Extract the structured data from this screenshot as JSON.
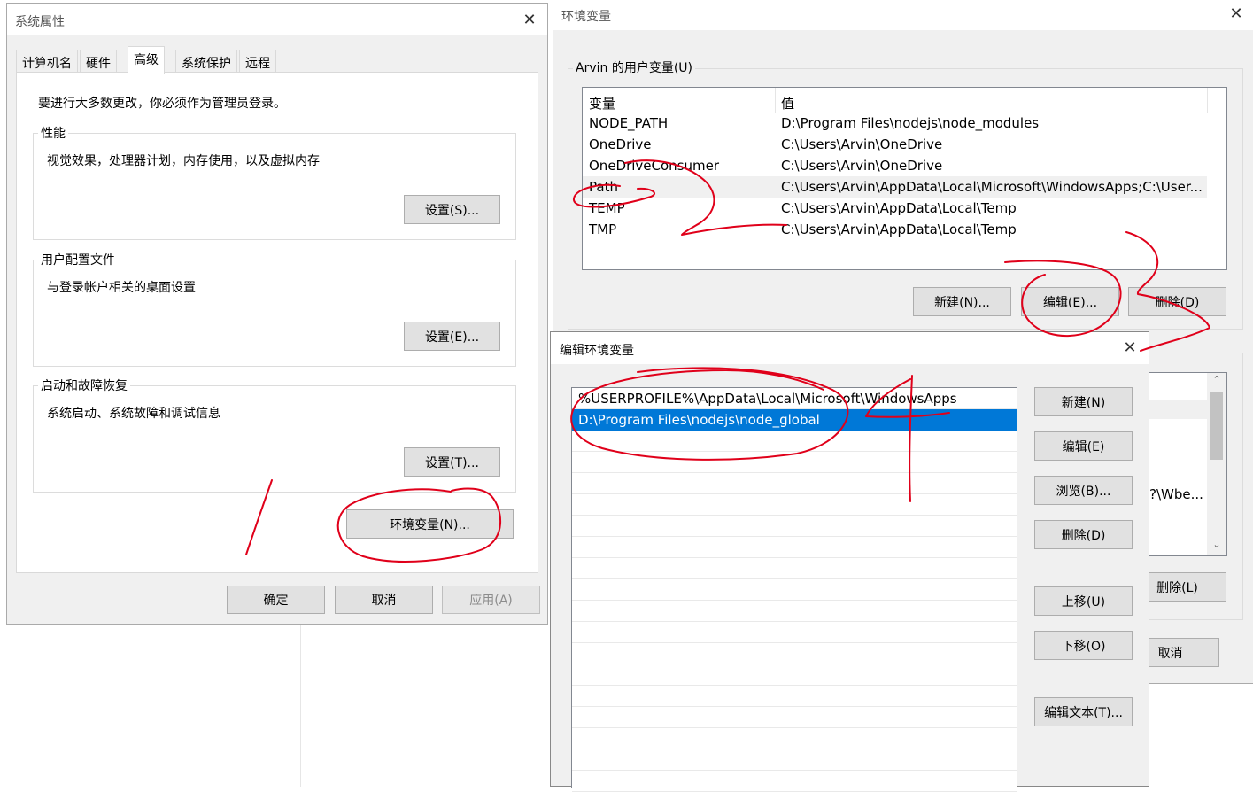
{
  "sys_props": {
    "title": "系统属性",
    "tabs": [
      "计算机名",
      "硬件",
      "高级",
      "系统保护",
      "远程"
    ],
    "notice": "要进行大多数更改，你必须作为管理员登录。",
    "groups": [
      {
        "label": "性能",
        "desc": "视觉效果，处理器计划，内存使用，以及虚拟内存",
        "button": "设置(S)..."
      },
      {
        "label": "用户配置文件",
        "desc": "与登录帐户相关的桌面设置",
        "button": "设置(E)..."
      },
      {
        "label": "启动和故障恢复",
        "desc": "系统启动、系统故障和调试信息",
        "button": "设置(T)..."
      }
    ],
    "env_button": "环境变量(N)...",
    "ok": "确定",
    "cancel": "取消",
    "apply": "应用(A)"
  },
  "env_vars": {
    "title": "环境变量",
    "user_group_label": "Arvin 的用户变量(U)",
    "columns": [
      "变量",
      "值"
    ],
    "rows": [
      {
        "name": "NODE_PATH",
        "value": "D:\\Program Files\\nodejs\\node_modules"
      },
      {
        "name": "OneDrive",
        "value": "C:\\Users\\Arvin\\OneDrive"
      },
      {
        "name": "OneDriveConsumer",
        "value": "C:\\Users\\Arvin\\OneDrive"
      },
      {
        "name": "Path",
        "value": "C:\\Users\\Arvin\\AppData\\Local\\Microsoft\\WindowsApps;C:\\User..."
      },
      {
        "name": "TEMP",
        "value": "C:\\Users\\Arvin\\AppData\\Local\\Temp"
      },
      {
        "name": "TMP",
        "value": "C:\\Users\\Arvin\\AppData\\Local\\Temp"
      }
    ],
    "new": "新建(N)...",
    "edit": "编辑(E)...",
    "delete": "删除(D)",
    "sys_partial_value": "?\\Wbe...",
    "sys_delete": "删除(L)",
    "cancel": "取消"
  },
  "edit_env": {
    "title": "编辑环境变量",
    "entries": [
      "%USERPROFILE%\\AppData\\Local\\Microsoft\\WindowsApps",
      "D:\\Program Files\\nodejs\\node_global"
    ],
    "buttons": {
      "new": "新建(N)",
      "edit": "编辑(E)",
      "browse": "浏览(B)...",
      "delete": "删除(D)",
      "move_up": "上移(U)",
      "move_down": "下移(O)",
      "edit_text": "编辑文本(T)..."
    }
  },
  "colors": {
    "selection": "#0078d7",
    "annotation": "#e0001a",
    "button_bg": "#e1e1e1"
  }
}
